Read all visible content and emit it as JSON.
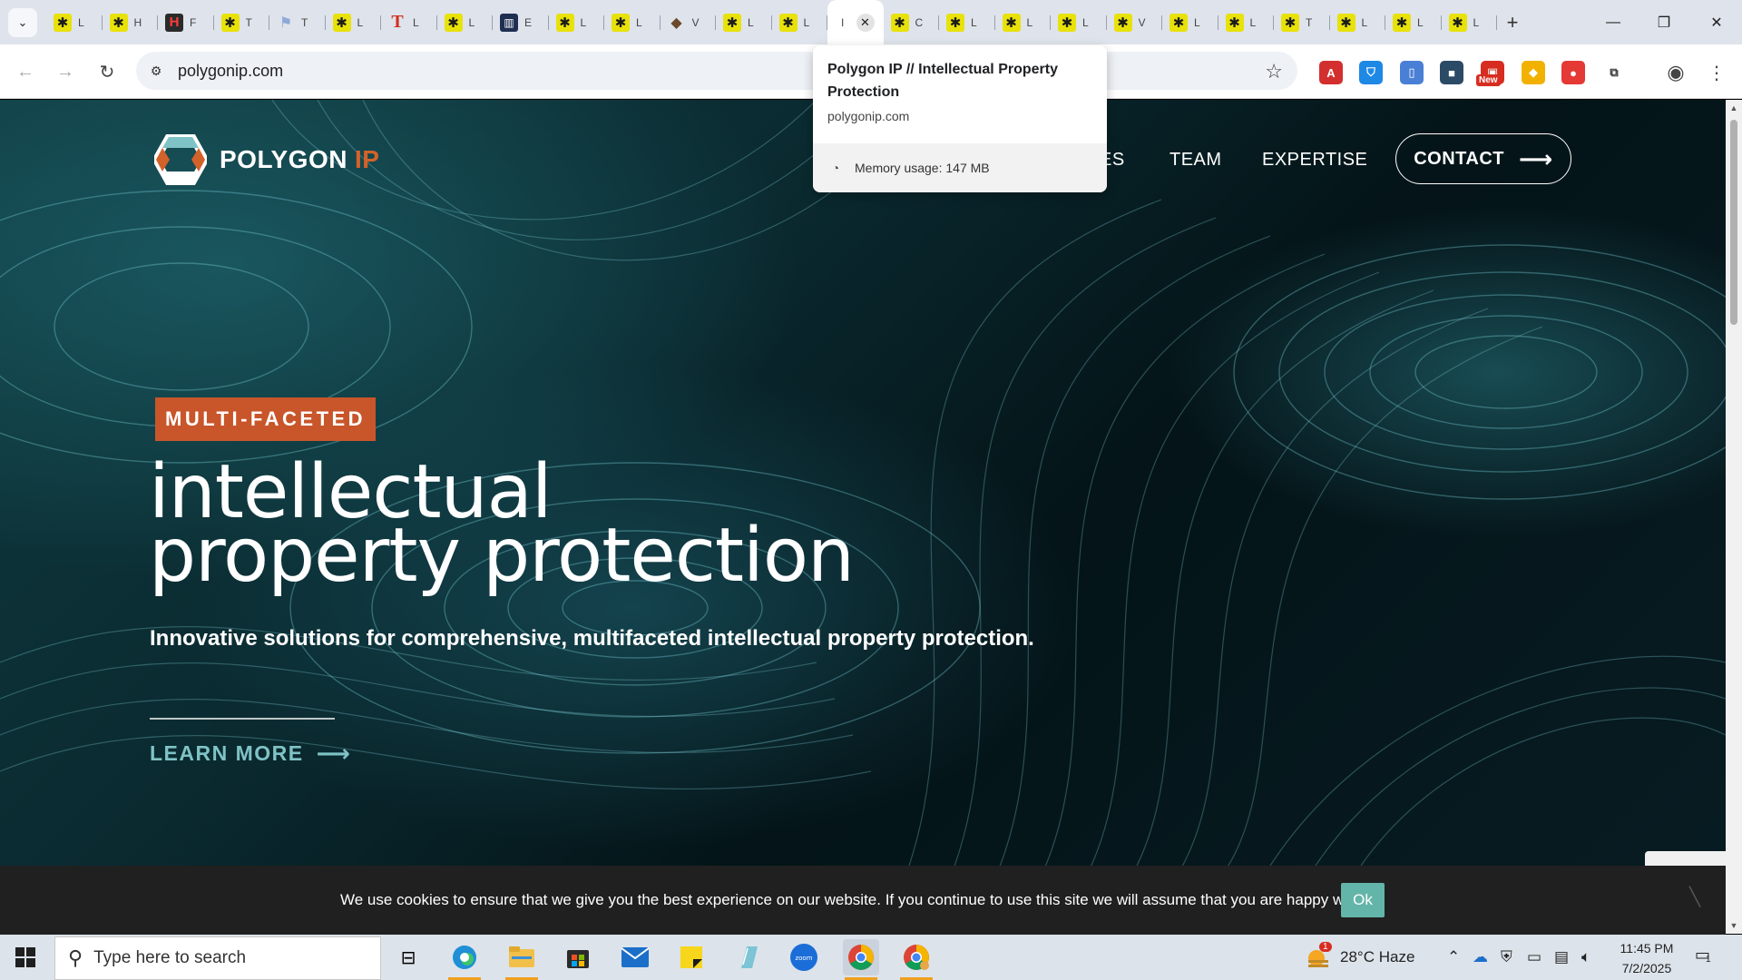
{
  "browser": {
    "tab_count_left": 13,
    "tabs": [
      {
        "favicon": "star",
        "glyph": "✱",
        "label": "L"
      },
      {
        "favicon": "star",
        "glyph": "✱",
        "label": "H"
      },
      {
        "favicon": "hx",
        "glyph": "H",
        "label": "F"
      },
      {
        "favicon": "star",
        "glyph": "✱",
        "label": "T"
      },
      {
        "favicon": "flag",
        "glyph": "⚑",
        "label": "T"
      },
      {
        "favicon": "star",
        "glyph": "✱",
        "label": "L"
      },
      {
        "favicon": "t",
        "glyph": "T",
        "label": "L"
      },
      {
        "favicon": "star",
        "glyph": "✱",
        "label": "L"
      },
      {
        "favicon": "book",
        "glyph": "▥",
        "label": "E"
      },
      {
        "favicon": "star",
        "glyph": "✱",
        "label": "L"
      },
      {
        "favicon": "star",
        "glyph": "✱",
        "label": "L"
      },
      {
        "favicon": "cap",
        "glyph": "◆",
        "label": "V"
      },
      {
        "favicon": "star",
        "glyph": "✱",
        "label": "L"
      },
      {
        "favicon": "star",
        "glyph": "✱",
        "label": "L"
      },
      {
        "favicon": "active",
        "glyph": "",
        "label": "I",
        "active": true
      },
      {
        "favicon": "star",
        "glyph": "✱",
        "label": "C"
      },
      {
        "favicon": "star",
        "glyph": "✱",
        "label": "L"
      },
      {
        "favicon": "star",
        "glyph": "✱",
        "label": "L"
      },
      {
        "favicon": "star",
        "glyph": "✱",
        "label": "L"
      },
      {
        "favicon": "star",
        "glyph": "✱",
        "label": "V"
      },
      {
        "favicon": "star",
        "glyph": "✱",
        "label": "L"
      },
      {
        "favicon": "star",
        "glyph": "✱",
        "label": "L"
      },
      {
        "favicon": "star",
        "glyph": "✱",
        "label": "T"
      },
      {
        "favicon": "star",
        "glyph": "✱",
        "label": "L"
      },
      {
        "favicon": "star",
        "glyph": "✱",
        "label": "L"
      },
      {
        "favicon": "star",
        "glyph": "✱",
        "label": "L"
      }
    ],
    "url": "polygonip.com",
    "hovercard": {
      "title": "Polygon IP // Intellectual Property Protection",
      "domain": "polygonip.com",
      "memory": "Memory usage: 147 MB"
    },
    "extensions": [
      {
        "name": "pdf-icon",
        "color": "#d32f2f",
        "glyph": "A"
      },
      {
        "name": "shield-icon",
        "color": "#1e88e5",
        "glyph": "⛉"
      },
      {
        "name": "docs-icon",
        "color": "#4a7fd6",
        "glyph": "▯"
      },
      {
        "name": "folder-icon",
        "color": "#2b4a66",
        "glyph": "■"
      },
      {
        "name": "new-extension-icon",
        "color": "#d62d20",
        "glyph": "▣",
        "badge": "New"
      },
      {
        "name": "honey-icon",
        "color": "#f2b100",
        "glyph": "◆"
      },
      {
        "name": "pokeball-icon",
        "color": "#e53935",
        "glyph": "●"
      },
      {
        "name": "puzzle-icon",
        "color": "#ffffff",
        "glyph": "⧉"
      }
    ]
  },
  "site": {
    "logo_name": "POLYGON",
    "logo_suffix": "IP",
    "nav": {
      "partial": "ES",
      "team": "TEAM",
      "expertise": "EXPERTISE",
      "contact": "CONTACT"
    },
    "badge": "MULTI-FACETED",
    "headline_line1": "intellectual",
    "headline_line2": "property protection",
    "subhead": "Innovative solutions for comprehensive, multifaceted intellectual property protection.",
    "learn_more": "LEARN MORE",
    "accent_color": "#c8562a",
    "link_color": "#7fc3c6"
  },
  "cookie": {
    "text": "We use cookies to ensure that we give you the best experience on our website. If you continue to use this site we will assume that you are happy with it.",
    "ok": "Ok"
  },
  "taskbar": {
    "search_placeholder": "Type here to search",
    "weather": "28°C  Haze",
    "weather_badge": "1",
    "time": "11:45 PM",
    "date": "7/2/2025",
    "notification_count": "1"
  }
}
